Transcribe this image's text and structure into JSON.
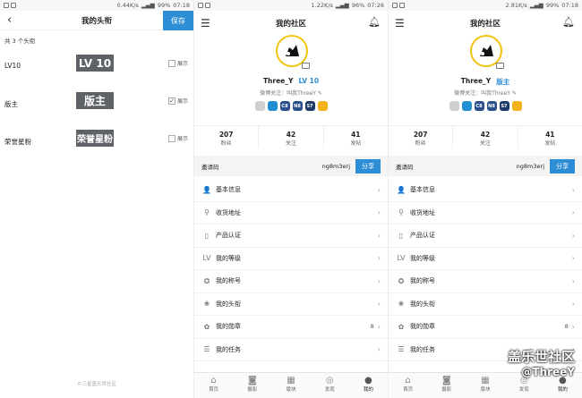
{
  "panel1": {
    "status": {
      "speed": "0.44K/s",
      "battery": "99%",
      "time": "07:18"
    },
    "title": "我的头衔",
    "save_label": "保存",
    "count_text": "共 3 个头衔",
    "titles": [
      {
        "name": "LV10",
        "badge": "LV 10",
        "show_label": "展示",
        "checked": false
      },
      {
        "name": "版主",
        "badge": "版主",
        "show_label": "展示",
        "checked": true
      },
      {
        "name": "荣誉星粉",
        "badge": "荣誉星粉",
        "show_label": "展示",
        "checked": false
      }
    ],
    "footer": "©三星盖乐世社区"
  },
  "panel2": {
    "status": {
      "speed": "1.22K/s",
      "battery": "96%",
      "time": "07:26"
    },
    "title": "我的社区",
    "username": "Three_Y",
    "level": "LV 10",
    "weibo": "微博关注：叫我ThreeY"
  },
  "panel3": {
    "status": {
      "speed": "2.81K/s",
      "battery": "99%",
      "time": "07:18"
    },
    "title": "我的社区",
    "username": "Three_Y",
    "level": "版主",
    "weibo": "微博关注：叫我ThreeY"
  },
  "stats": [
    {
      "num": "207",
      "label": "粉丝"
    },
    {
      "num": "42",
      "label": "关注"
    },
    {
      "num": "41",
      "label": "发帖"
    }
  ],
  "invite": {
    "label": "邀请码",
    "code": "ng8m3erj",
    "share": "分享"
  },
  "medals": [
    {
      "text": "",
      "color": "#d0d0d0"
    },
    {
      "text": "",
      "color": "#1f8fd2"
    },
    {
      "text": "C8",
      "color": "#2a4f8a"
    },
    {
      "text": "N8",
      "color": "#2a4f8a"
    },
    {
      "text": "S7",
      "color": "#1e3a66"
    },
    {
      "text": "",
      "color": "#f2b21a"
    }
  ],
  "menu": [
    {
      "label": "基本信息",
      "icon": "user-icon",
      "glyph": "👤"
    },
    {
      "label": "收货地址",
      "icon": "location-icon",
      "glyph": "⚲"
    },
    {
      "label": "产品认证",
      "icon": "phone-icon",
      "glyph": "▯"
    },
    {
      "label": "我的等级",
      "icon": "level-icon",
      "glyph": "LV"
    },
    {
      "label": "我的称号",
      "icon": "badge-icon",
      "glyph": "✪"
    },
    {
      "label": "我的头衔",
      "icon": "title-icon",
      "glyph": "❀"
    },
    {
      "label": "我的勋章",
      "icon": "medal-icon",
      "glyph": "✿",
      "count": "8"
    },
    {
      "label": "我的任务",
      "icon": "task-icon",
      "glyph": "☰"
    }
  ],
  "nav": [
    {
      "label": "首页",
      "icon": "home-icon",
      "glyph": "⌂"
    },
    {
      "label": "摄影",
      "icon": "camera-icon",
      "glyph": "◙"
    },
    {
      "label": "版块",
      "icon": "grid-icon",
      "glyph": "▦"
    },
    {
      "label": "发现",
      "icon": "compass-icon",
      "glyph": "◎"
    },
    {
      "label": "我的",
      "icon": "person-icon",
      "glyph": "●"
    }
  ],
  "watermark": {
    "line1": "盖乐世社区",
    "line2": "@ThreeY"
  },
  "colors": {
    "accent": "#2d8ed6",
    "badge_bg": "#5f6368",
    "avatar_ring": "#f1c40f"
  }
}
